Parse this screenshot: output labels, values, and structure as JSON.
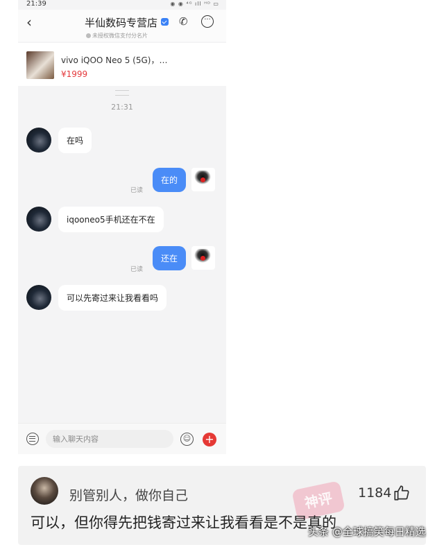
{
  "status_bar": {
    "time": "21:39",
    "icons": "◉ ◉ ⁴ᴳ ıll ᴴᴰ ▭"
  },
  "header": {
    "back_icon": "‹",
    "title": "半仙数码专营店",
    "subtitle": "未授权微信支付分名片",
    "more_icon": "···",
    "phone_icon": "✆"
  },
  "product": {
    "name": "vivo iQOO Neo 5 (5G)，…",
    "price": "¥1999"
  },
  "timestamp": "21:31",
  "messages": [
    {
      "side": "left",
      "text": "在吗"
    },
    {
      "side": "right",
      "text": "在的",
      "status": "已读"
    },
    {
      "side": "left",
      "text": "iqooneo5手机还在不在"
    },
    {
      "side": "right",
      "text": "还在",
      "status": "已读"
    },
    {
      "side": "left",
      "text": "可以先寄过来让我看看吗"
    }
  ],
  "input": {
    "placeholder": "输入聊天内容",
    "emoji_icon": "☺",
    "plus_icon": "+"
  },
  "comment": {
    "user": "别管别人，做你自己",
    "likes": "1184",
    "text": "可以，但你得先把钱寄过来让我看看是不是真的",
    "stamp": "神评"
  },
  "watermark": "头条 @全球搞笑每日精选",
  "colors": {
    "bubble_blue": "#4a8cf7",
    "price_red": "#e4393c",
    "plus_red": "#e53935",
    "verified_blue": "#3b82f6"
  }
}
